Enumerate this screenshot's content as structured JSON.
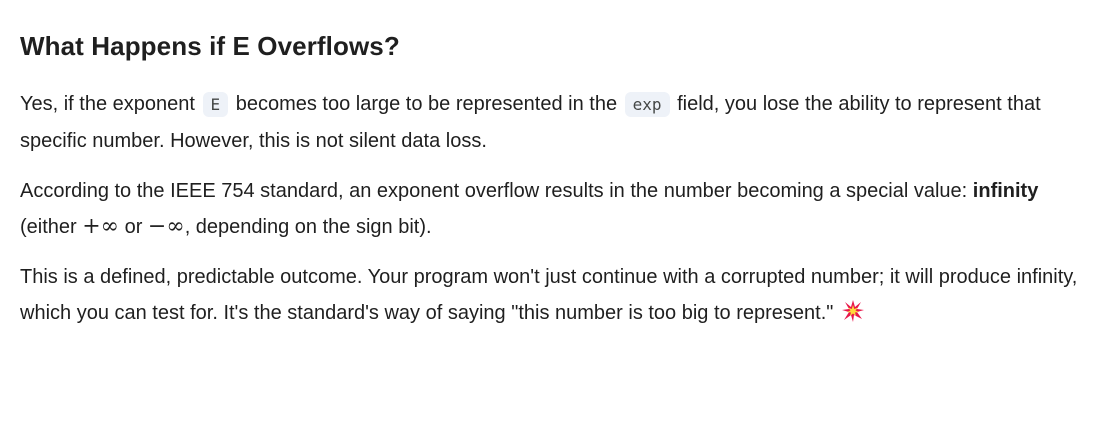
{
  "heading": "What Happens if E Overflows?",
  "p1": {
    "t1": "Yes, if the exponent ",
    "code1": "E",
    "t2": " becomes too large to be represented in the ",
    "code2": "exp",
    "t3": " field, you lose the ability to represent that specific number. However, this is not silent data loss."
  },
  "p2": {
    "t1": "According to the IEEE 754 standard, an exponent overflow results in the number becoming a special value: ",
    "bold": "infinity",
    "t2": " (either ",
    "plus_inf": "+∞",
    "t3": " or ",
    "minus_inf": "−∞",
    "t4": ", depending on the sign bit)."
  },
  "p3": {
    "text": "This is a defined, predictable outcome. Your program won't just continue with a corrupted number; it will produce infinity, which you can test for. It's the standard's way of saying \"this number is too big to represent.\"",
    "emoji_icon": "collision-icon",
    "emoji_color": "#e8174b"
  }
}
